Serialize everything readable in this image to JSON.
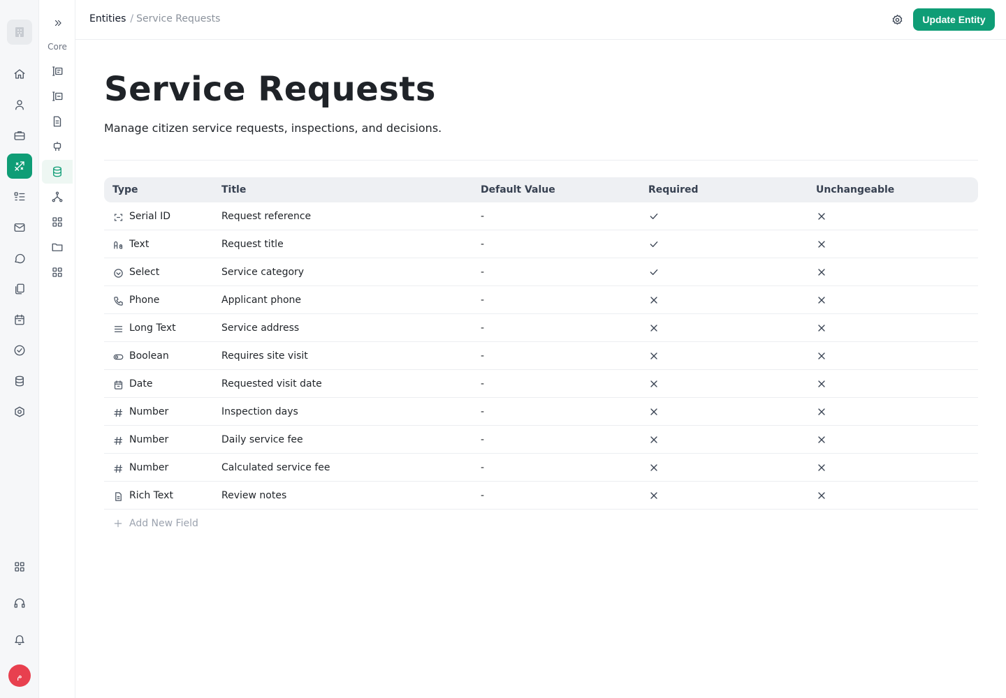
{
  "breadcrumb": {
    "root": "Entities",
    "separator": "/",
    "current": "Service Requests"
  },
  "header": {
    "update_label": "Update Entity"
  },
  "page": {
    "title": "Service Requests",
    "description": "Manage citizen service requests, inspections, and decisions."
  },
  "subnav": {
    "section_label": "Core"
  },
  "table": {
    "headers": {
      "type": "Type",
      "title": "Title",
      "default": "Default Value",
      "required": "Required",
      "unchangeable": "Unchangeable"
    },
    "rows": [
      {
        "icon": "serial-id-icon",
        "type": "Serial ID",
        "title": "Request reference",
        "default": "-",
        "required": true,
        "unchangeable": false
      },
      {
        "icon": "text-icon",
        "type": "Text",
        "title": "Request title",
        "default": "-",
        "required": true,
        "unchangeable": false
      },
      {
        "icon": "select-icon",
        "type": "Select",
        "title": "Service category",
        "default": "-",
        "required": true,
        "unchangeable": false
      },
      {
        "icon": "phone-icon",
        "type": "Phone",
        "title": "Applicant phone",
        "default": "-",
        "required": false,
        "unchangeable": false
      },
      {
        "icon": "long-text-icon",
        "type": "Long Text",
        "title": "Service address",
        "default": "-",
        "required": false,
        "unchangeable": false
      },
      {
        "icon": "boolean-icon",
        "type": "Boolean",
        "title": "Requires site visit",
        "default": "-",
        "required": false,
        "unchangeable": false
      },
      {
        "icon": "date-icon",
        "type": "Date",
        "title": "Requested visit date",
        "default": "-",
        "required": false,
        "unchangeable": false
      },
      {
        "icon": "number-icon",
        "type": "Number",
        "title": "Inspection days",
        "default": "-",
        "required": false,
        "unchangeable": false
      },
      {
        "icon": "number-icon",
        "type": "Number",
        "title": "Daily service fee",
        "default": "-",
        "required": false,
        "unchangeable": false
      },
      {
        "icon": "number-icon",
        "type": "Number",
        "title": "Calculated service fee",
        "default": "-",
        "required": false,
        "unchangeable": false
      },
      {
        "icon": "rich-text-icon",
        "type": "Rich Text",
        "title": "Review notes",
        "default": "-",
        "required": false,
        "unchangeable": false
      }
    ],
    "add_label": "Add New Field"
  },
  "colors": {
    "accent": "#0f9d76",
    "avatar": "#e8404f",
    "header_bg": "#eef0f3"
  }
}
